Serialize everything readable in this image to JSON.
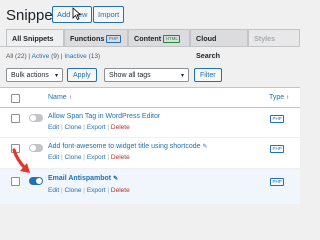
{
  "header": {
    "title": "Snippets",
    "add_new": "Add New",
    "import": "Import"
  },
  "tabs": [
    {
      "label": "All Snippets",
      "badge": ""
    },
    {
      "label": "Functions",
      "badge": "PHP"
    },
    {
      "label": "Content",
      "badge": "HTML"
    },
    {
      "label": "Cloud Search",
      "badge": ""
    },
    {
      "label": "Styles",
      "badge": ""
    }
  ],
  "filters": {
    "all": "All",
    "all_count": "(22)",
    "active": "Active",
    "active_count": "(9)",
    "inactive": "Inactive",
    "inactive_count": "(13)"
  },
  "toolbar": {
    "bulk_actions": "Bulk actions",
    "apply": "Apply",
    "tags": "Show all tags",
    "filter": "Filter"
  },
  "table": {
    "col_name": "Name",
    "col_name_sort": "↑",
    "col_type": "Type",
    "col_type_sort": "↑",
    "actions": {
      "edit": "Edit",
      "clone": "Clone",
      "export": "Export",
      "delete": "Delete"
    },
    "rows": [
      {
        "name": "Allow Span Tag in WordPress Editor",
        "type": "PHP",
        "active": false
      },
      {
        "name": "Add font-awesome to widget title using shortcode",
        "type": "PHP",
        "active": false
      },
      {
        "name": "Email Antispambot",
        "type": "PHP",
        "active": true
      }
    ]
  },
  "colors": {
    "accent": "#2271b1",
    "delete": "#b32d2e",
    "arrow": "#e0392b"
  }
}
